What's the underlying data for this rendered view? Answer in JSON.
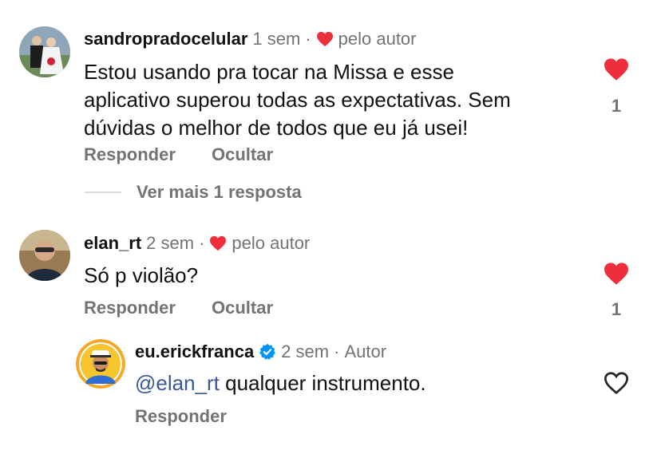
{
  "comments": [
    {
      "username": "sandropradocelular",
      "time": "1 sem",
      "separator": "·",
      "liked_by_author": "pelo autor",
      "text_lines": [
        "Estou usando pra tocar na Missa e esse",
        "aplicativo superou todas as expectativas. Sem",
        "dúvidas o melhor de todos que eu já usei!"
      ],
      "reply_label": "Responder",
      "hide_label": "Ocultar",
      "like_count": "1",
      "liked": true,
      "view_more": "Ver mais 1 resposta"
    },
    {
      "username": "elan_rt",
      "time": "2 sem",
      "separator": "·",
      "liked_by_author": "pelo autor",
      "text": "Só p violão?",
      "reply_label": "Responder",
      "hide_label": "Ocultar",
      "like_count": "1",
      "liked": true
    }
  ],
  "reply": {
    "username": "eu.erickfranca",
    "time": "2 sem",
    "separator": "·",
    "role": "Autor",
    "mention": "@elan_rt",
    "text": " qualquer instrumento.",
    "reply_label": "Responder",
    "liked": false
  },
  "colors": {
    "heart_red": "#ed2f3c",
    "meta_gray": "#737373",
    "mention_blue": "#385898",
    "verified_blue": "#0095f6"
  }
}
